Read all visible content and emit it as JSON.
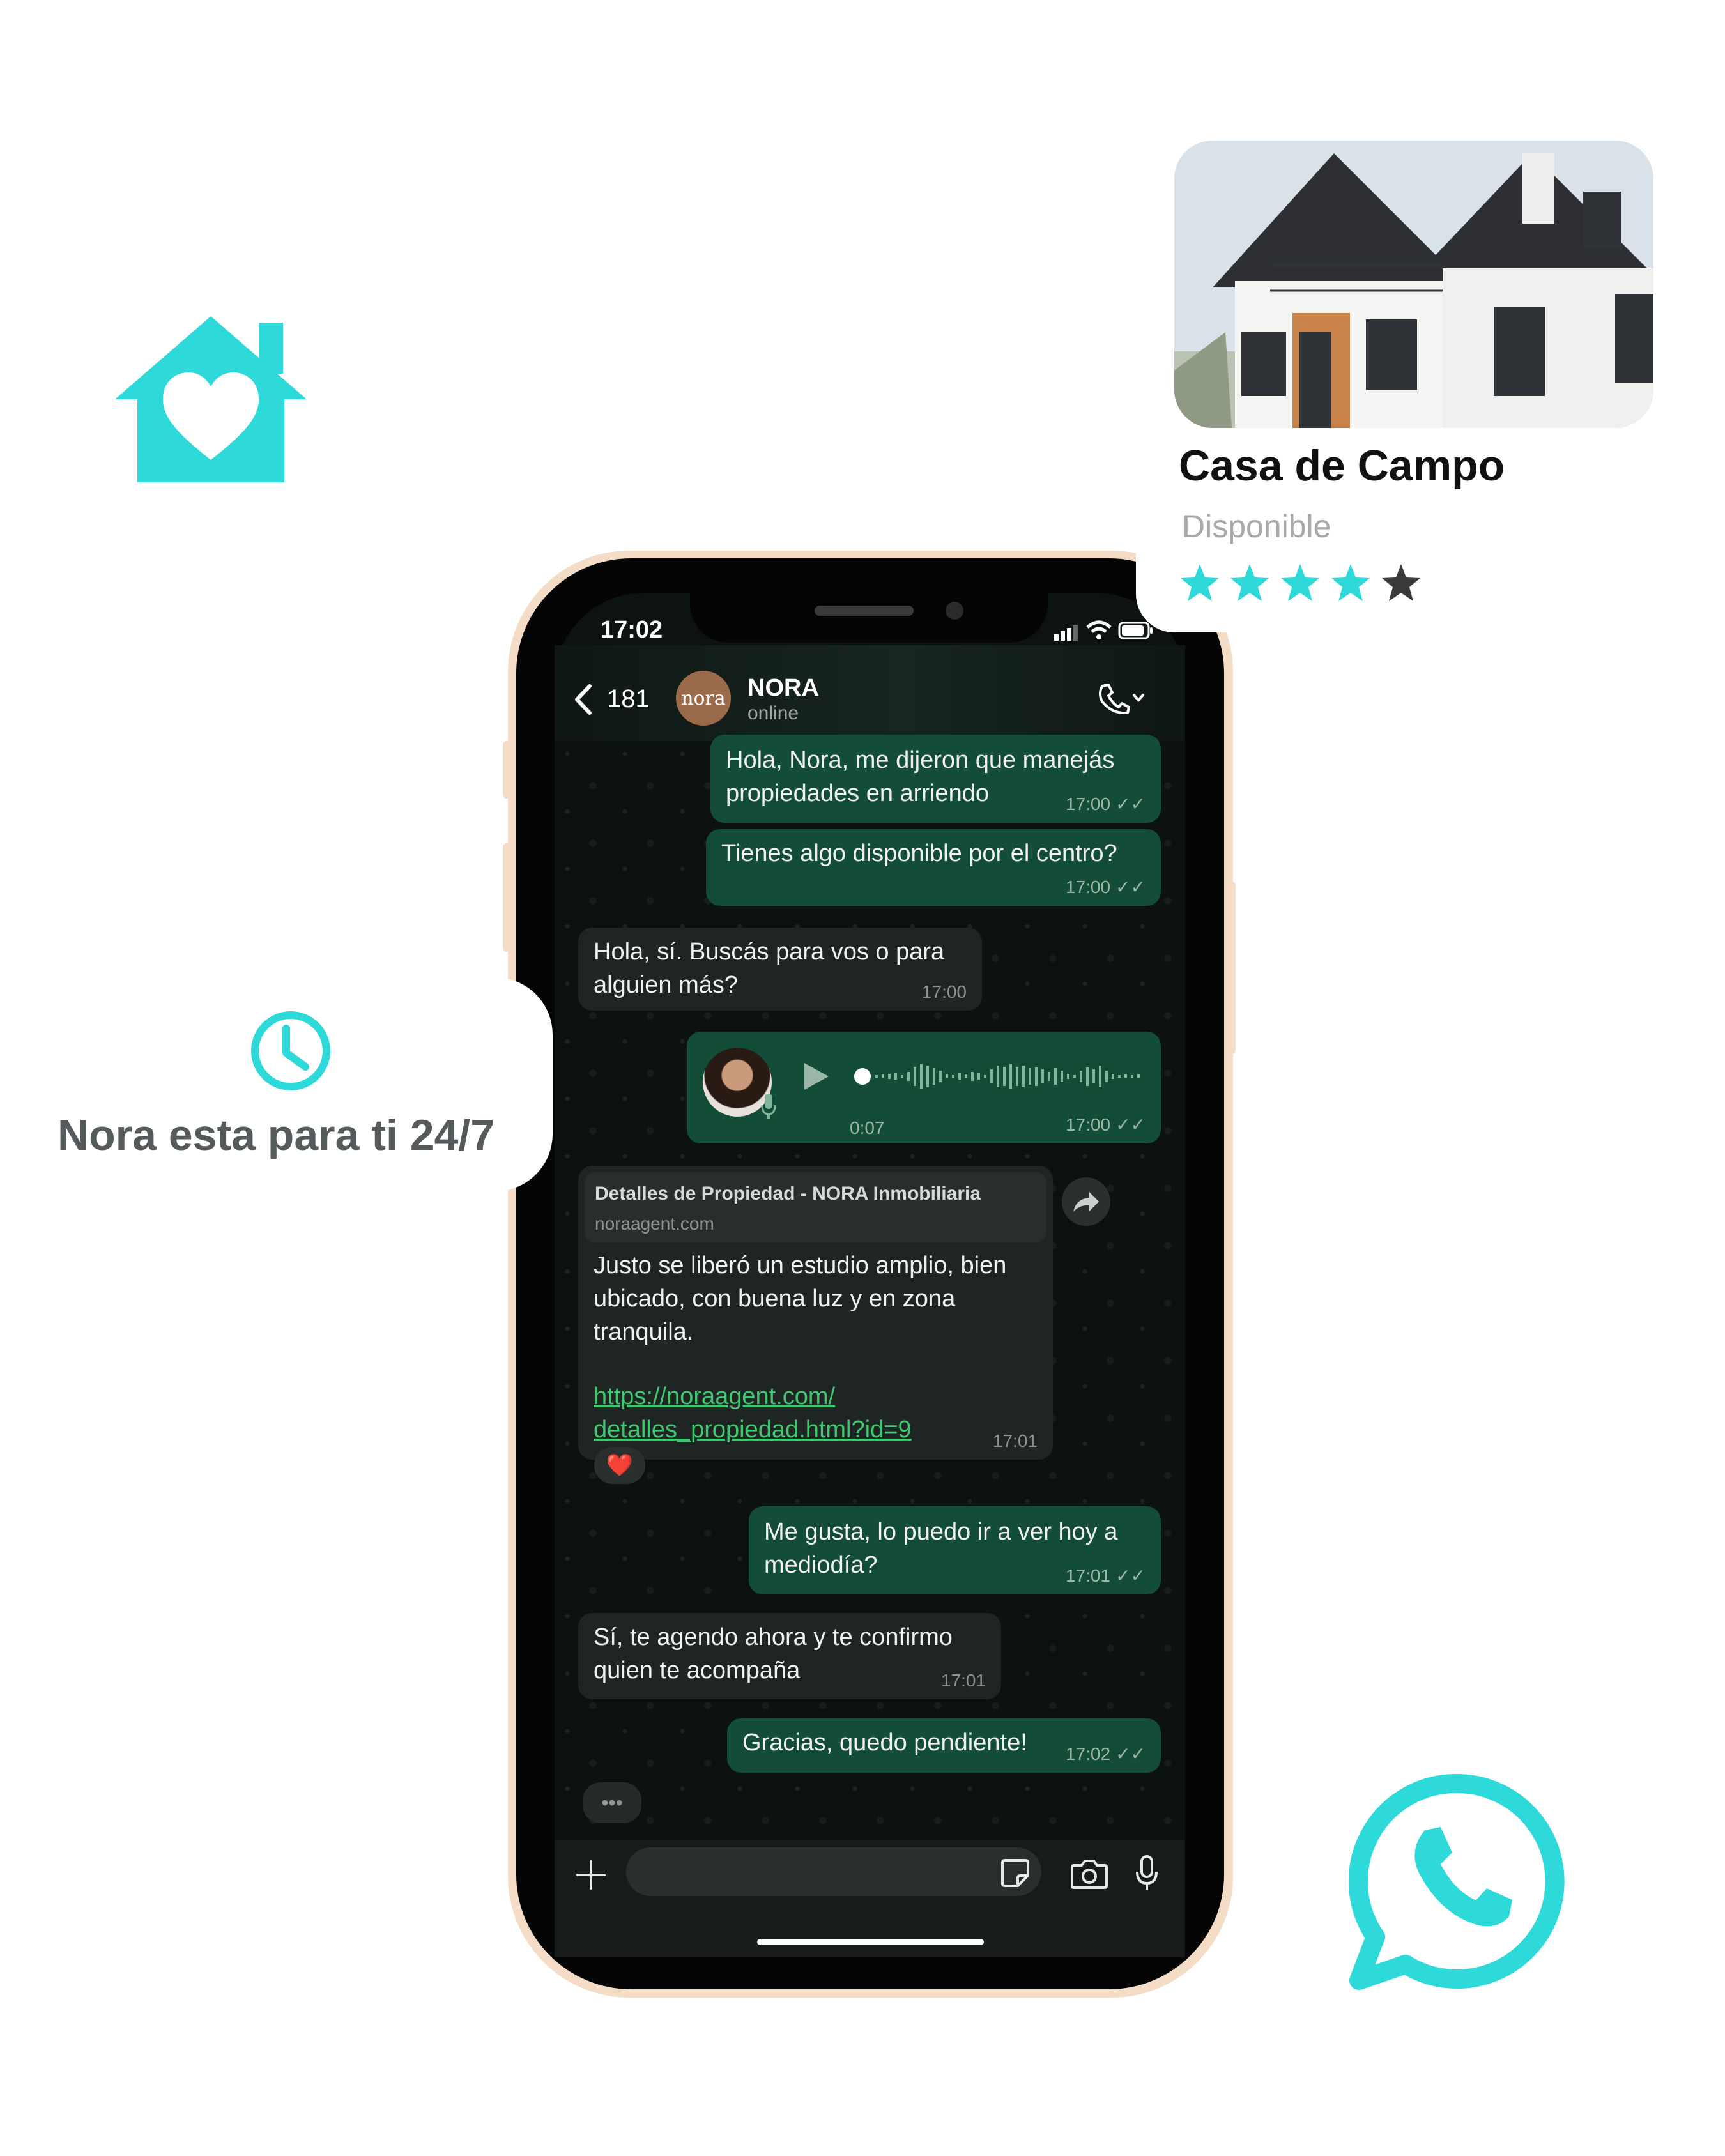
{
  "accent_color": "#2ed9d9",
  "decor": {
    "house_icon": "house-heart-icon",
    "whatsapp_icon": "whatsapp-icon"
  },
  "tagline": {
    "icon": "clock-icon",
    "text": "Nora esta para ti 24/7"
  },
  "property_card": {
    "title": "Casa de Campo",
    "status": "Disponible",
    "rating": 4,
    "rating_max": 5
  },
  "status_bar": {
    "time": "17:02"
  },
  "chat_header": {
    "back_count": "181",
    "avatar_text": "nora",
    "contact_name": "NORA",
    "contact_status": "online"
  },
  "messages": [
    {
      "dir": "out",
      "text": "Hola, Nora, me dijeron que manejás\npropiedades en arriendo",
      "time": "17:00"
    },
    {
      "dir": "out",
      "text": "Tienes algo disponible por el centro?",
      "time": "17:00"
    },
    {
      "dir": "in",
      "text": "Hola, sí. Buscás para vos o para\nalguien más?",
      "time": "17:00"
    },
    {
      "dir": "out",
      "type": "voice",
      "duration": "0:07",
      "time": "17:00"
    },
    {
      "dir": "in",
      "type": "link",
      "preview_title": "Detalles de Propiedad - NORA Inmobiliaria",
      "preview_domain": "noraagent.com",
      "text": "Justo se liberó un estudio amplio, bien\nubicado, con buena luz y en zona\ntranquila.",
      "link": "https://noraagent.com/\ndetalles_propiedad.html?id=9",
      "time": "17:01",
      "reaction": "❤️"
    },
    {
      "dir": "out",
      "text": "Me gusta, lo puedo ir a ver hoy a\nmediodía?",
      "time": "17:01"
    },
    {
      "dir": "in",
      "text": "Sí, te agendo ahora y te confirmo\nquien te acompaña",
      "time": "17:01"
    },
    {
      "dir": "out",
      "text": "Gracias, quedo pendiente!",
      "time": "17:02"
    }
  ],
  "typing_indicator": "•••"
}
